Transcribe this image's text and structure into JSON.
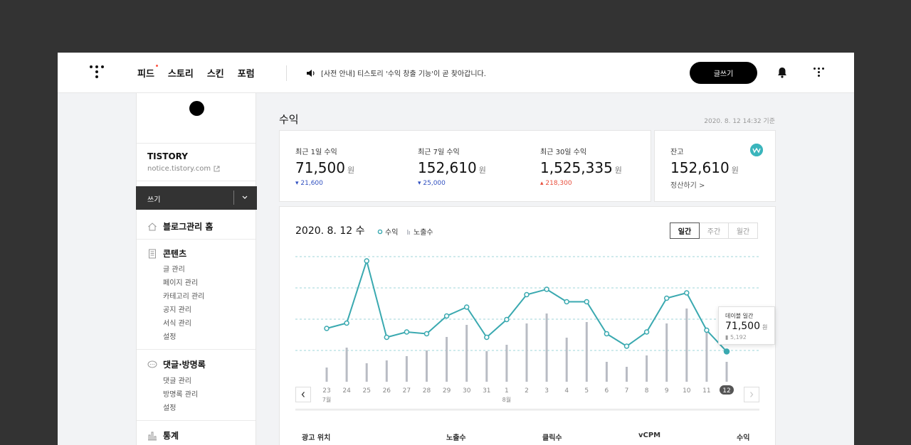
{
  "topbar": {
    "nav": [
      "피드",
      "스토리",
      "스킨",
      "포럼"
    ],
    "notice": "[사전 안내] 티스토리 '수익 창출 기능'이 곧 찾아갑니다.",
    "write_label": "글쓰기"
  },
  "sidebar": {
    "blog_name": "TISTORY",
    "blog_url": "notice.tistory.com",
    "write_label": "쓰기",
    "sections": [
      {
        "title": "블로그관리 홈",
        "icon": "home-icon",
        "items": []
      },
      {
        "title": "콘텐츠",
        "icon": "document-icon",
        "items": [
          "글 관리",
          "페이지 관리",
          "카테고리 관리",
          "공지 관리",
          "서식 관리",
          "설정"
        ]
      },
      {
        "title": "댓글·방명록",
        "icon": "comment-icon",
        "items": [
          "댓글 관리",
          "방명록 관리",
          "설정"
        ]
      },
      {
        "title": "통계",
        "icon": "stats-icon",
        "items": []
      }
    ]
  },
  "main": {
    "title": "수익",
    "as_of": "2020. 8. 12 14:32 기준",
    "stats": [
      {
        "label": "최근 1일 수익",
        "value": "71,500",
        "unit": "원",
        "change": "21,600",
        "direction": "down"
      },
      {
        "label": "최근 7일 수익",
        "value": "152,610",
        "unit": "원",
        "change": "25,000",
        "direction": "down"
      },
      {
        "label": "최근 30일 수익",
        "value": "1,525,335",
        "unit": "원",
        "change": "218,300",
        "direction": "up"
      }
    ],
    "balance": {
      "label": "잔고",
      "value": "152,610",
      "unit": "원",
      "settle_label": "정산하기 >"
    },
    "chart_panel": {
      "date": "2020. 8. 12 수",
      "legend_revenue": "수익",
      "legend_impressions": "노출수",
      "period_tabs": [
        "일간",
        "주간",
        "월간"
      ],
      "active_tab": "일간",
      "tooltip": {
        "label": "데이블 일간",
        "value": "71,500",
        "unit": "원",
        "impressions": "5,192"
      }
    },
    "table_headers": [
      "광고 위치",
      "노출수",
      "클릭수",
      "vCPM",
      "수익"
    ]
  },
  "chart_data": {
    "type": "line",
    "categories": [
      "23",
      "24",
      "25",
      "26",
      "27",
      "28",
      "29",
      "30",
      "31",
      "1",
      "2",
      "3",
      "4",
      "5",
      "6",
      "7",
      "8",
      "9",
      "10",
      "11",
      "12"
    ],
    "month_labels": [
      {
        "index": 0,
        "label": "7월"
      },
      {
        "index": 9,
        "label": "8월"
      }
    ],
    "highlight_index": 20,
    "series": [
      {
        "name": "수익",
        "type": "line",
        "color": "#3aa9b0",
        "values": [
          30,
          33,
          68,
          25,
          28,
          27,
          37,
          42,
          25,
          35,
          49,
          52,
          45,
          45,
          27,
          20,
          28,
          47,
          50,
          29,
          17
        ]
      },
      {
        "name": "노출수",
        "type": "bar",
        "color": "#b9bcc4",
        "values": [
          20,
          48,
          26,
          30,
          36,
          44,
          63,
          80,
          43,
          52,
          82,
          96,
          62,
          84,
          28,
          21,
          37,
          82,
          103,
          74,
          28
        ]
      }
    ],
    "grid": true,
    "legend": "top"
  }
}
